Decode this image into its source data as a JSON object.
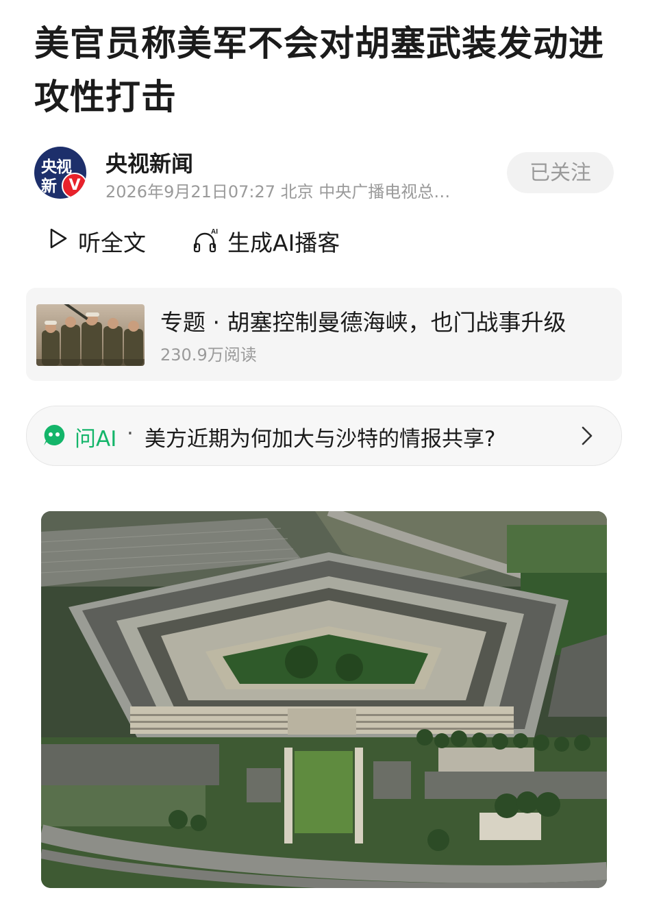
{
  "article": {
    "title": "美官员称美军不会对胡塞武装发动进攻性打击"
  },
  "author": {
    "avatar_line1": "央视",
    "avatar_line2": "新",
    "badge": "V",
    "name": "央视新闻",
    "meta": "2026年9月21日07:27 北京 中央广播电视总…",
    "follow_label": "已关注"
  },
  "actions": {
    "listen_label": "听全文",
    "listen_icon": "play-outline-icon",
    "podcast_label": "生成AI播客",
    "podcast_icon": "headphones-ai-icon",
    "podcast_icon_text": "AI"
  },
  "topic": {
    "title": "专题 · 胡塞控制曼德海峡，也门战事升级",
    "reads": "230.9万阅读"
  },
  "ask_ai": {
    "label": "问AI",
    "separator": "·",
    "question": "美方近期为何加大与沙特的情报共享?",
    "icon": "ai-chat-icon",
    "chevron_icon": "chevron-right-icon",
    "accent": "#14b56a"
  },
  "colors": {
    "text": "#1b1b1b",
    "muted": "#9a9a9a",
    "card_bg": "#f5f5f5",
    "brand_blue": "#1d2f6b",
    "badge_red": "#e8222b"
  }
}
